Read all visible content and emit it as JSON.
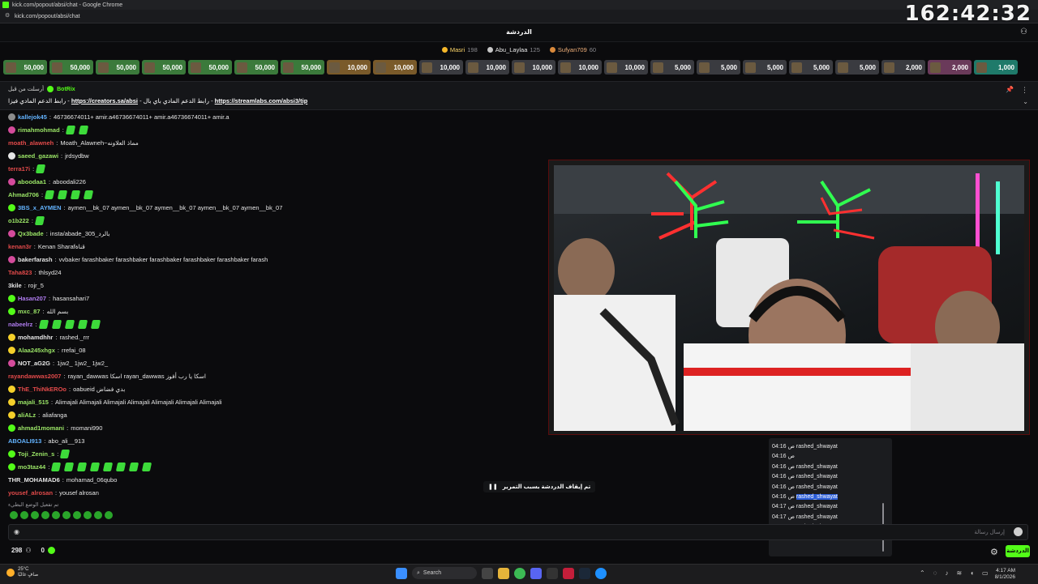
{
  "window": {
    "title": "kick.com/popout/absi/chat - Google Chrome",
    "url": "kick.com/popout/absi/chat"
  },
  "timer": "162:42:32",
  "chat": {
    "title": "الدردشة"
  },
  "leaderboard": [
    {
      "name": "Masri",
      "points": "198"
    },
    {
      "name": "Abu_Laylaa",
      "points": "125"
    },
    {
      "name": "Sufyan709",
      "points": "60"
    }
  ],
  "gifts": [
    "50,000",
    "50,000",
    "50,000",
    "50,000",
    "50,000",
    "50,000",
    "50,000",
    "10,000",
    "10,000",
    "10,000",
    "10,000",
    "10,000",
    "10,000",
    "10,000",
    "5,000",
    "5,000",
    "5,000",
    "5,000",
    "5,000",
    "2,000",
    "2,000",
    "1,000"
  ],
  "gift_colors": [
    "#3b7a3b",
    "#3b7a3b",
    "#3b7a3b",
    "#3b7a3b",
    "#3b7a3b",
    "#3b7a3b",
    "#3b7a3b",
    "#7a5a2a",
    "#7a5a2a",
    "#3a3b40",
    "#3a3b40",
    "#3a3b40",
    "#3a3b40",
    "#3a3b40",
    "#3a3b40",
    "#3a3b40",
    "#3a3b40",
    "#3a3b40",
    "#3a3b40",
    "#3a3b40",
    "#6a3a5a",
    "#1f7a6a"
  ],
  "pinned": {
    "by": "BotRix",
    "from": "أرسلت من قبل",
    "prefix": "رابط الدعم المادي فيزا - ",
    "link1": "https://creators.sa/absi",
    "middle": " - رابط الدعم المادي باي بال - ",
    "link2": "https://streamlabs.com/absi3/tip"
  },
  "messages": [
    {
      "user": "kallejok45",
      "text": "46736674011+ amir.a46736674011+ amir.a46736674011+ amir.a",
      "color": "#63b3ff",
      "badge": "#8c8c8c"
    },
    {
      "user": "rimahmohmad",
      "text": "",
      "emotes": 2,
      "color": "#9be567",
      "badge": "#d44b9b"
    },
    {
      "user": "moath_alawneh",
      "text": "Moath_Alawneh~مماذ العلاونه",
      "color": "#e24a4a",
      "badge": ""
    },
    {
      "user": "saeed_gazawi",
      "text": "jrdsydbw",
      "color": "#9be567",
      "badge": "#e6e6e6"
    },
    {
      "user": "terra17i",
      "text": "",
      "emotes": 1,
      "color": "#e24a4a",
      "badge": ""
    },
    {
      "user": "aboodaa1",
      "text": "aboodali226",
      "color": "#9be567",
      "badge": "#d44b9b"
    },
    {
      "user": "Ahmad706",
      "text": "",
      "emotes": 4,
      "color": "#9be567",
      "badge": ""
    },
    {
      "user": "3BS_x_AYMEN",
      "text": "aymen__bk_07 aymen__bk_07 aymen__bk_07 aymen__bk_07 aymen__bk_07",
      "color": "#63b3ff",
      "badge": "#53fc18"
    },
    {
      "user": "o1b222",
      "text": "",
      "emotes": 1,
      "color": "#9be567",
      "badge": ""
    },
    {
      "user": "Qx3bade",
      "text": "insta/abade_305_بالرد",
      "color": "#9be567",
      "badge": "#d44b9b"
    },
    {
      "user": "kenan3r",
      "text": "Kenan Sharafقناة",
      "color": "#e24a4a",
      "badge": ""
    },
    {
      "user": "bakerfarash",
      "text": "vvbaker farashbaker farashbaker farashbaker farashbaker farashbaker farash",
      "color": "#e6e6e6",
      "badge": "#d44b9b"
    },
    {
      "user": "Taha823",
      "text": "thlsyd24",
      "color": "#e24a4a",
      "badge": ""
    },
    {
      "user": "3kile",
      "text": "rojr_5",
      "color": "#e6e6e6",
      "badge": ""
    },
    {
      "user": "Hasan207",
      "text": "hasansahari7",
      "color": "#b07cf0",
      "badge": "#53fc18"
    },
    {
      "user": "mxc_87",
      "text": "بسم الله",
      "color": "#9be567",
      "badge": "#53fc18"
    },
    {
      "user": "nabeelrz",
      "text": "",
      "emotes": 5,
      "color": "#b07cf0",
      "badge": ""
    },
    {
      "user": "mohamdhhr",
      "text": "rashed._rrr",
      "color": "#e6e6e6",
      "badge": "#f5d02a"
    },
    {
      "user": "Alaa245xhgx",
      "text": "rrefai_08",
      "color": "#9be567",
      "badge": "#f5d02a"
    },
    {
      "user": "NOT_aG2G",
      "text": "1jw2_ 1jw2_ 1jw2_",
      "color": "#e6e6e6",
      "badge": "#d44b9b"
    },
    {
      "user": "rayandawwas2007",
      "text": "rayan_dawwas اسكا rayan_dawwas اسكا يا رب أفوز",
      "color": "#e24a4a",
      "badge": ""
    },
    {
      "user": "ThE_ThiNkEROo",
      "text": "oabueid بدي فضاض",
      "color": "#e24a4a",
      "badge": "#f5d02a"
    },
    {
      "user": "majali_515",
      "text": "Alimajali Alimajali Alimajali Alimajali Alimajali Alimajali Alimajali",
      "color": "#9be567",
      "badge": "#f5d02a"
    },
    {
      "user": "aliALz",
      "text": "aliafanga",
      "color": "#9be567",
      "badge": "#f5d02a"
    },
    {
      "user": "ahmad1momani",
      "text": "momani990",
      "color": "#9be567",
      "badge": "#53fc18"
    },
    {
      "user": "ABOALI913",
      "text": "abo_ali__913",
      "color": "#63b3ff",
      "badge": ""
    },
    {
      "user": "Toji_Zenin_s",
      "text": "",
      "emotes": 1,
      "color": "#9be567",
      "badge": "#53fc18"
    },
    {
      "user": "mo3taz44",
      "text": "",
      "emotes": 8,
      "color": "#9be567",
      "badge": "#53fc18"
    },
    {
      "user": "THR_MOHAMAD6",
      "text": "mohamad_06qubo",
      "color": "#e6e6e6",
      "badge": ""
    },
    {
      "user": "yousef_alrosan",
      "text": "yousef alrosan",
      "color": "#e24a4a",
      "badge": ""
    }
  ],
  "note": "تم تفعيل الوضع البطيء",
  "paused_text": "تم إيقاف الدردشة بسبب التمرير",
  "input": {
    "placeholder": "إرسال رسالة"
  },
  "footer": {
    "viewers": "298",
    "kicks": "0",
    "send_label": "الدردشة"
  },
  "popup_rows": [
    {
      "time": "04:16 ص",
      "user": "rashed_shwayat",
      "selected": false
    },
    {
      "time": "04:16 ص",
      "user": "",
      "selected": false
    },
    {
      "time": "04:16 ص",
      "user": "rashed_shwayat",
      "selected": false
    },
    {
      "time": "04:16 ص",
      "user": "rashed_shwayat",
      "selected": false
    },
    {
      "time": "04:16 ص",
      "user": "rashed_shwayat",
      "selected": false
    },
    {
      "time": "04:16 ص",
      "user": "rashed_shwayat",
      "selected": true
    },
    {
      "time": "04:17 ص",
      "user": "rashed_shwayat",
      "selected": false
    },
    {
      "time": "04:17 ص",
      "user": "rashed_shwayat",
      "selected": false
    },
    {
      "time": "04:17 ص",
      "user": "rashed_shwayat",
      "selected": false
    },
    {
      "time": "04:17 ص",
      "user": "rashed_shwayat",
      "selected": false
    }
  ],
  "taskbar": {
    "temp": "25°C",
    "weather": "صافٍ غالبًا",
    "search": "Search",
    "time": "4:17 AM",
    "date": "8/1/2026"
  }
}
